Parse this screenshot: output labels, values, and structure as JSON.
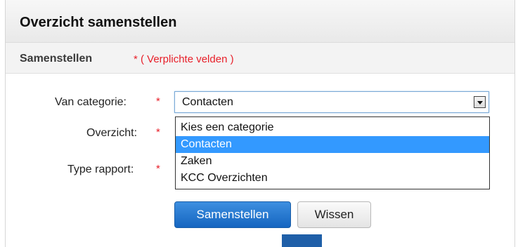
{
  "header": {
    "title": "Overzicht samenstellen"
  },
  "section": {
    "title": "Samenstellen",
    "required_note": "* ( Verplichte velden )"
  },
  "form": {
    "fields": [
      {
        "label": "Van categorie:",
        "required": "*"
      },
      {
        "label": "Overzicht:",
        "required": "*"
      },
      {
        "label": "Type rapport:",
        "required": "*"
      }
    ],
    "category_select": {
      "value": "Contacten",
      "options": [
        "Kies een categorie",
        "Contacten",
        "Zaken",
        "KCC Overzichten"
      ],
      "selected_index": 1
    }
  },
  "buttons": {
    "submit_label": "Samenstellen",
    "clear_label": "Wissen"
  },
  "colors": {
    "required": "#e8202a",
    "selection": "#3399ff",
    "primary_button": "#1565c0"
  },
  "icons": {
    "dropdown_arrow": "chevron-down-icon"
  }
}
